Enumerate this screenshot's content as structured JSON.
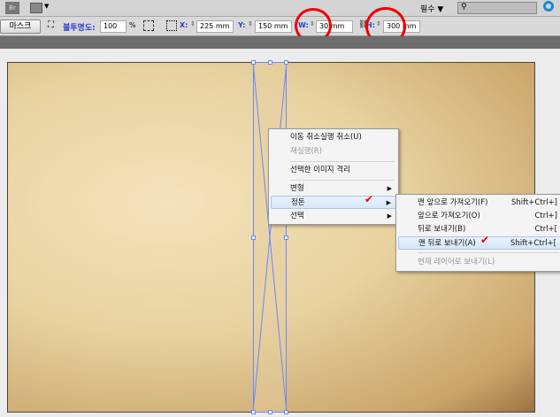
{
  "topbar": {
    "bridge_label": "Br",
    "workspace": "필수",
    "search_placeholder": ""
  },
  "controls": {
    "mask_button": "마스크",
    "opacity_label": "불투명도:",
    "opacity_value": "100",
    "opacity_unit": "%",
    "x_label": "X:",
    "x_value": "225 mm",
    "y_label": "Y:",
    "y_value": "150 mm",
    "w_label": "W:",
    "w_value": "30 mm",
    "h_label": "H:",
    "h_value": "300 mm"
  },
  "context_menu": {
    "items": [
      {
        "label": "이동 취소실행 취소(U)"
      },
      {
        "label": "재실행(R)"
      },
      {
        "label": "선택한 이미지 격리"
      },
      {
        "label": "변형"
      },
      {
        "label": "정돈"
      },
      {
        "label": "선택"
      }
    ]
  },
  "submenu": {
    "items": [
      {
        "label": "맨 앞으로 가져오기(F)",
        "shortcut": "Shift+Ctrl+]"
      },
      {
        "label": "앞으로 가져오기(O)",
        "shortcut": "Ctrl+]"
      },
      {
        "label": "뒤로 보내기(B)",
        "shortcut": "Ctrl+["
      },
      {
        "label": "맨 뒤로 보내기(A)",
        "shortcut": "Shift+Ctrl+["
      },
      {
        "label": "현재 레이어로 보내기(L)",
        "shortcut": ""
      }
    ]
  },
  "colors": {
    "annotation": "#e00000",
    "selection": "#6a86ff"
  }
}
